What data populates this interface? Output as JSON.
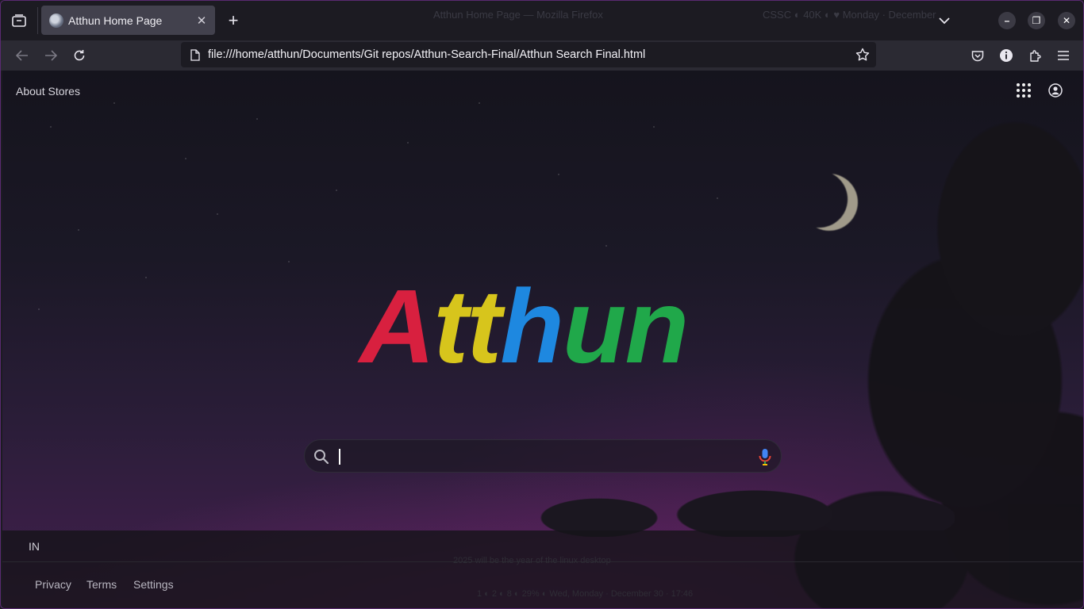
{
  "browser": {
    "tab": {
      "title": "Atthun Home Page",
      "close_glyph": "✕"
    },
    "new_tab_glyph": "+",
    "url": "file:///home/atthun/Documents/Git repos/Atthun-Search-Final/Atthun Search Final.html",
    "window_controls": {
      "minimize": "–",
      "restore": "❐",
      "close": "✕"
    },
    "background_window_title": "Atthun Home Page — Mozilla Firefox",
    "background_status": "CSSC ◐ 40K ◐   ♥   Monday · December"
  },
  "page": {
    "top_left_link": "About Stores",
    "logo": {
      "letters": [
        {
          "char": "A",
          "color": "#d8203f"
        },
        {
          "char": "t",
          "color": "#d7c51c"
        },
        {
          "char": "t",
          "color": "#d7c51c"
        },
        {
          "char": "h",
          "color": "#1e88e0"
        },
        {
          "char": "u",
          "color": "#20a84a"
        },
        {
          "char": "n",
          "color": "#20a84a"
        }
      ]
    },
    "search": {
      "value": "",
      "placeholder": ""
    },
    "footer": {
      "country": "IN",
      "links": [
        "Privacy",
        "Terms",
        "Settings"
      ],
      "faint_center": "2025 will be the year of the linux desktop",
      "faint_bottom": "1 ◐    2 ◐    8 ◐         29% ◐   Wed, Monday · December 30 · 17:46"
    }
  },
  "icons": {
    "tab_list": "tab-list-icon",
    "back": "arrow-left-icon",
    "forward": "arrow-right-icon",
    "reload": "reload-icon",
    "page": "page-icon",
    "bookmark": "star-icon",
    "pocket": "pocket-icon",
    "info": "info-icon",
    "extensions": "puzzle-icon",
    "menu": "hamburger-icon",
    "apps": "apps-grid-icon",
    "account": "account-icon",
    "search": "search-icon",
    "mic": "microphone-icon"
  }
}
